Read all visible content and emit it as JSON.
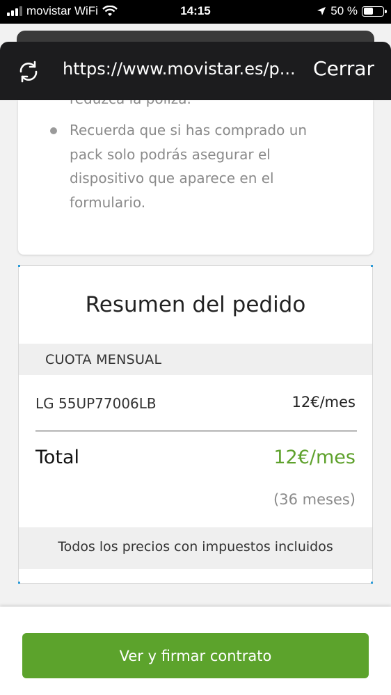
{
  "status_bar": {
    "carrier": "movistar WiFi",
    "time": "14:15",
    "battery": "50 %",
    "battery_level": 0.5
  },
  "browser": {
    "url": "https://www.movistar.es/p...",
    "close_label": "Cerrar"
  },
  "info_card": {
    "cut_text": "reduzca la póliza.",
    "bullet": "Recuerda que si has comprado un pack solo podrás asegurar el dispositivo que aparece en el formulario."
  },
  "summary": {
    "title": "Resumen del pedido",
    "section_label": "CUOTA MENSUAL",
    "item_name": "LG 55UP77006LB",
    "item_price": "12€/mes",
    "total_label": "Total",
    "total_price": "12€/mes",
    "months": "(36 meses)",
    "tax_note": "Todos los precios con impuestos incluidos"
  },
  "actions": {
    "sign_button": "Ver y firmar contrato"
  },
  "colors": {
    "accent_green": "#5ca32c",
    "total_green": "#5ea12c"
  }
}
